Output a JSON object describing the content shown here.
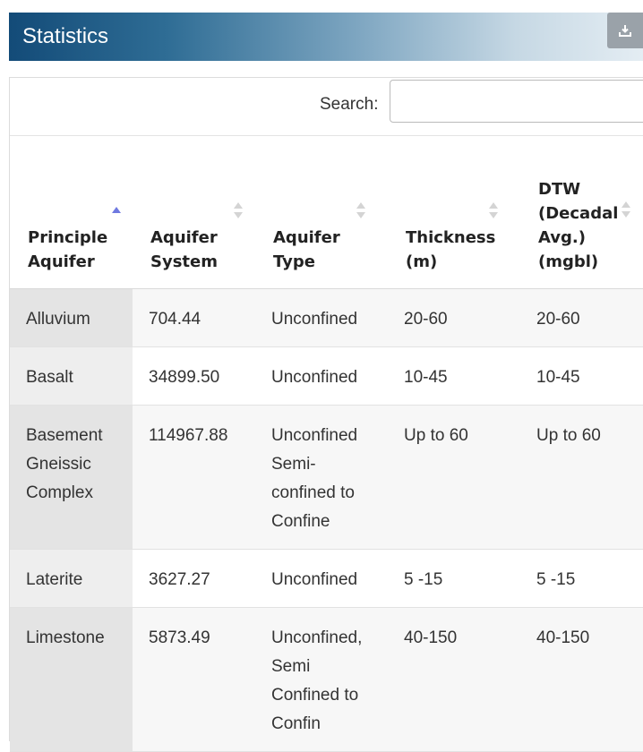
{
  "header": {
    "title": "Statistics",
    "download_icon": "download-icon"
  },
  "search": {
    "label": "Search:",
    "value": "",
    "placeholder": ""
  },
  "table": {
    "columns": [
      {
        "lines": [
          "Principle",
          "Aquifer"
        ],
        "sort": "ascending"
      },
      {
        "lines": [
          "Aquifer",
          "System"
        ],
        "sort": "none"
      },
      {
        "lines": [
          "Aquifer",
          "Type"
        ],
        "sort": "none"
      },
      {
        "lines": [
          "Thickness",
          "(m)"
        ],
        "sort": "none"
      },
      {
        "lines": [
          "DTW",
          "(Decadal",
          "Avg.)",
          "(mgbl)"
        ],
        "sort": "none"
      }
    ],
    "rows": [
      {
        "cells": [
          [
            "Alluvium"
          ],
          [
            "704.44"
          ],
          [
            "Unconfined"
          ],
          [
            "20-60"
          ],
          [
            "20-60"
          ]
        ]
      },
      {
        "cells": [
          [
            "Basalt"
          ],
          [
            "34899.50"
          ],
          [
            "Unconfined"
          ],
          [
            "10-45"
          ],
          [
            "10-45"
          ]
        ]
      },
      {
        "cells": [
          [
            "Basement",
            "Gneissic",
            "Complex"
          ],
          [
            "114967.88"
          ],
          [
            "Unconfined",
            "Semi-",
            "confined to",
            "Confine"
          ],
          [
            "Up to 60"
          ],
          [
            "Up to 60"
          ]
        ]
      },
      {
        "cells": [
          [
            "Laterite"
          ],
          [
            "3627.27"
          ],
          [
            "Unconfined"
          ],
          [
            "5 -15"
          ],
          [
            "5 -15"
          ]
        ]
      },
      {
        "cells": [
          [
            "Limestone"
          ],
          [
            "5873.49"
          ],
          [
            "Unconfined,",
            "Semi",
            "Confined to",
            "Confin"
          ],
          [
            "40-150"
          ],
          [
            "40-150"
          ]
        ]
      }
    ]
  },
  "colors": {
    "header_start": "#134b78",
    "sort_active": "#6f79e0",
    "sort_inactive": "#d4d4d4"
  }
}
